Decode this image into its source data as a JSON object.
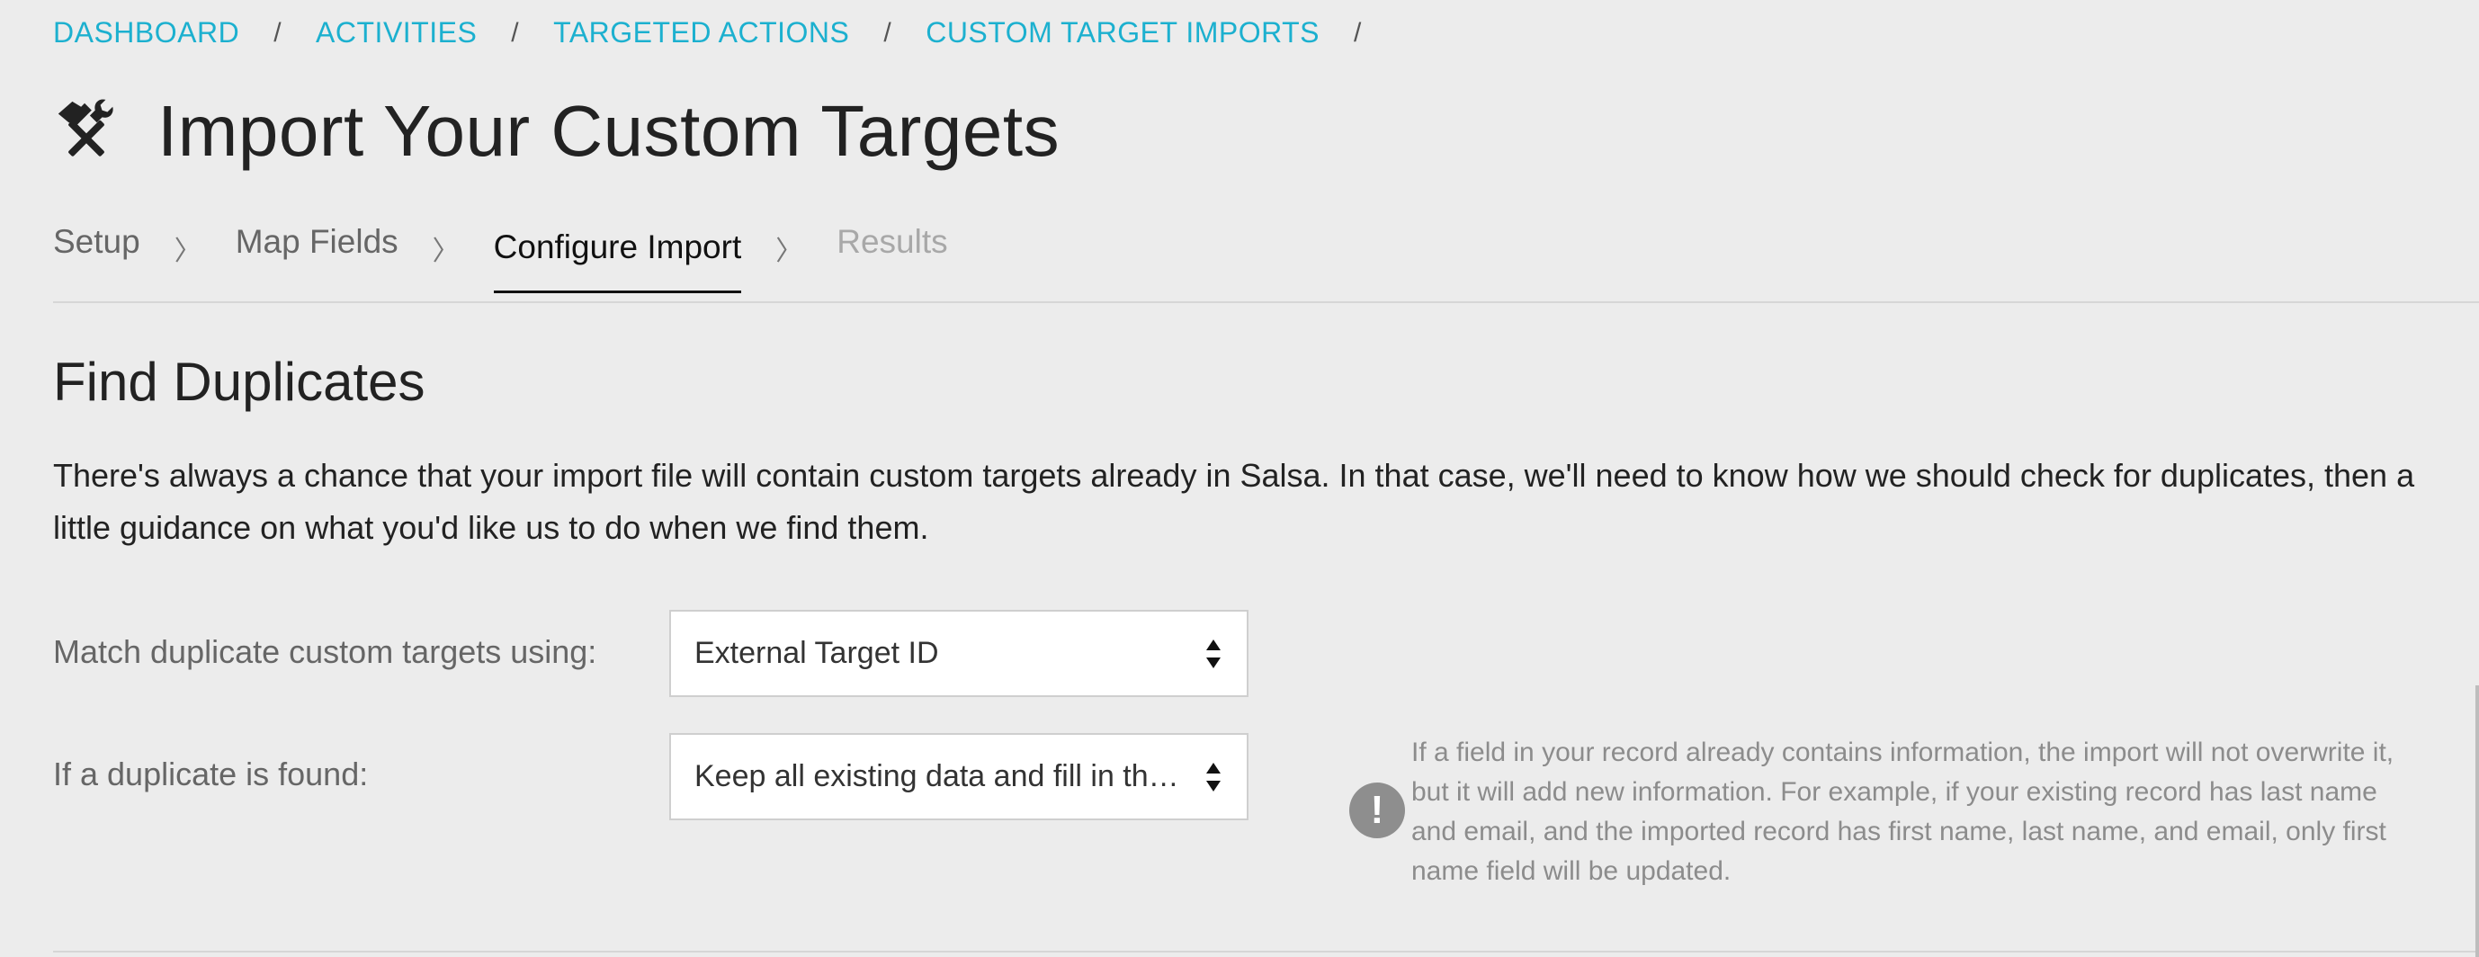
{
  "breadcrumb": {
    "items": [
      "DASHBOARD",
      "ACTIVITIES",
      "TARGETED ACTIONS",
      "CUSTOM TARGET IMPORTS"
    ],
    "separator": "/"
  },
  "page": {
    "title": "Import Your Custom Targets",
    "icon": "tools-icon"
  },
  "steps": {
    "items": [
      "Setup",
      "Map Fields",
      "Configure Import",
      "Results"
    ],
    "active": "Configure Import",
    "chevron": "〉"
  },
  "section": {
    "title": "Find Duplicates",
    "description": "There's always a chance that your import file will contain custom targets already in Salsa. In that case, we'll need to know how we should check for duplicates, then a little guidance on what you'd like us to do when we find them."
  },
  "form": {
    "match_label": "Match duplicate custom targets using:",
    "match_value": "External Target ID",
    "duplicate_label": "If a duplicate is found:",
    "duplicate_value": "Keep all existing data and fill in the blanks"
  },
  "help": {
    "icon_glyph": "!",
    "text": "If a field in your record already contains information, the import will not overwrite it, but it will add new information. For example, if your existing record has last name and email, and the imported record has first name, last name, and email, only first name field will be updated."
  },
  "colors": {
    "background": "#ececec",
    "link": "#1cb0cf",
    "muted_text": "#8c8c8c"
  }
}
